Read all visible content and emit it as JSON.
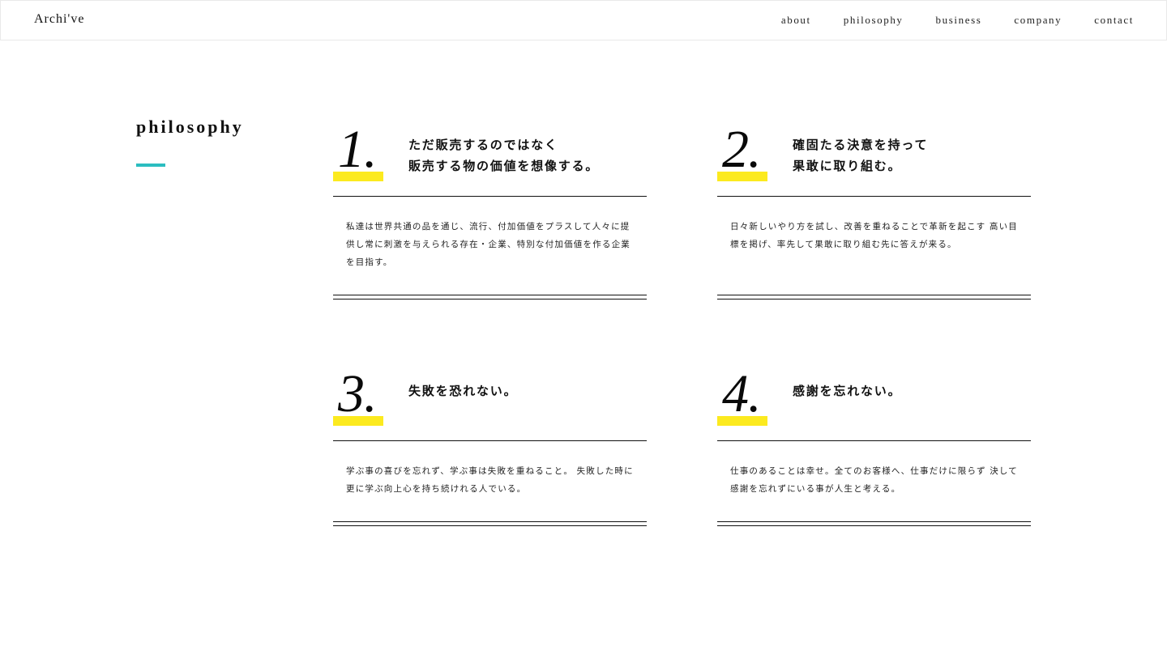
{
  "header": {
    "logo": "Archi've",
    "nav": [
      "about",
      "philosophy",
      "business",
      "company",
      "contact"
    ]
  },
  "section": {
    "title": "philosophy",
    "accent_color": "#2bbdc0",
    "highlight_color": "#fcea1f"
  },
  "cards": [
    {
      "number": "1.",
      "heading": [
        "ただ販売するのではなく",
        "販売する物の価値を想像する。"
      ],
      "body": "私達は世界共通の品を通じ、流行、付加価値をプラスして人々に提供し常に刺激を与えられる存在・企業、特別な付加価値を作る企業を目指す。"
    },
    {
      "number": "2.",
      "heading": [
        "確固たる決意を持って",
        "果敢に取り組む。"
      ],
      "body": "日々新しいやり方を試し、改善を重ねることで革新を起こす 高い目標を掲げ、率先して果敢に取り組む先に答えが来る。"
    },
    {
      "number": "3.",
      "heading": [
        "失敗を恐れない。"
      ],
      "body": "学ぶ事の喜びを忘れず、学ぶ事は失敗を重ねること。 失敗した時に更に学ぶ向上心を持ち続けれる人でいる。"
    },
    {
      "number": "4.",
      "heading": [
        "感謝を忘れない。"
      ],
      "body": "仕事のあることは幸せ。全てのお客様へ、仕事だけに限らず 決して感謝を忘れずにいる事が人生と考える。"
    }
  ]
}
